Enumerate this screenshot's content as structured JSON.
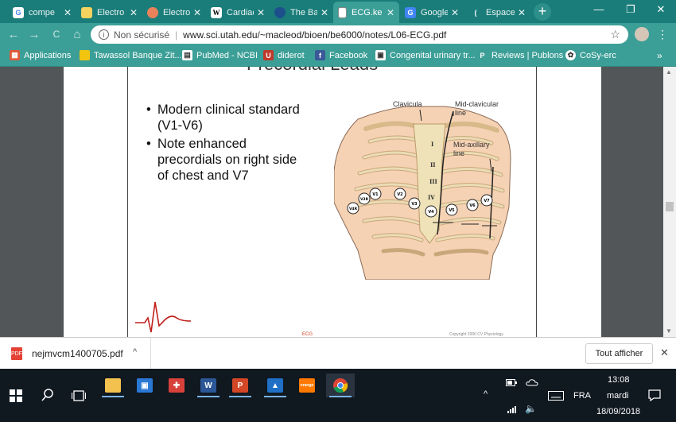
{
  "tabs": [
    {
      "label": "compe",
      "fav_text": "G",
      "fav_bg": "#ffffff",
      "fav_fg": "#4285f4"
    },
    {
      "label": "Electro",
      "fav_text": "",
      "fav_bg": "#f4d35e",
      "fav_fg": "#333"
    },
    {
      "label": "Electro",
      "fav_text": "",
      "fav_bg": "#e9825a",
      "fav_fg": "#fff"
    },
    {
      "label": "Cardiac",
      "fav_text": "W",
      "fav_bg": "#ffffff",
      "fav_fg": "#000"
    },
    {
      "label": "The Ba",
      "fav_text": "",
      "fav_bg": "#1d4f8c",
      "fav_fg": "#fff"
    },
    {
      "label": "ECG.ke",
      "fav_text": "",
      "fav_bg": "#ffffff",
      "fav_fg": "#555"
    },
    {
      "label": "Google",
      "fav_text": "G",
      "fav_bg": "#4285f4",
      "fav_fg": "#fff"
    },
    {
      "label": "Espace",
      "fav_text": "(",
      "fav_bg": "#3c9f97",
      "fav_fg": "#fff"
    }
  ],
  "window": {
    "minimize": "—",
    "restore": "❐",
    "close": "✕"
  },
  "address": {
    "security_label": "Non sécurisé",
    "url": "www.sci.utah.edu/~macleod/bioen/be6000/notes/L06-ECG.pdf"
  },
  "nav": {
    "back": "←",
    "forward": "→",
    "reload": "C",
    "home": "⌂"
  },
  "bookmarks": [
    {
      "label": "Applications",
      "icon_bg": "#e05a3a",
      "icon_text": "▦"
    },
    {
      "label": "Tawassol Banque Zit...",
      "icon_bg": "#f1c40f",
      "icon_text": ""
    },
    {
      "label": "PubMed - NCBI",
      "icon_bg": "#ffffff",
      "icon_text": "▤"
    },
    {
      "label": "diderot",
      "icon_bg": "#c0392b",
      "icon_text": "U"
    },
    {
      "label": "Facebook",
      "icon_bg": "#3b5998",
      "icon_text": "f"
    },
    {
      "label": "Congenital urinary tr...",
      "icon_bg": "#ffffff",
      "icon_text": "▣"
    },
    {
      "label": "Reviews | Publons",
      "icon_bg": "#3c9f97",
      "icon_text": "P"
    },
    {
      "label": "CoSy-erc",
      "icon_bg": "#ffffff",
      "icon_text": "✿"
    }
  ],
  "bookmarks_more": "»",
  "slide": {
    "title": "Precordial Leads",
    "bullets": [
      {
        "text": "Modern clinical standard\n(V1-V6)"
      },
      {
        "text": "Note enhanced\nprecordials on right side\nof chest and V7"
      }
    ],
    "figure_labels": {
      "clavicula": "Clavicula",
      "mid_clavicular": "Mid-clavicular\nline",
      "mid_axillary": "Mid-axillary\nline",
      "ribs": [
        "I",
        "II",
        "III",
        "IV"
      ],
      "leads": [
        "V4R",
        "V3R",
        "V1",
        "V2",
        "V3",
        "V4",
        "V5",
        "V6",
        "V7"
      ]
    },
    "footer_left": "ECG",
    "footer_right": "Copyright 2000 CV Physiology"
  },
  "download": {
    "filename": "nejmvcm1400705.pdf",
    "show_all": "Tout afficher",
    "close": "✕",
    "file_icon_text": "PDF"
  },
  "taskbar": {
    "time": "13:08",
    "day": "mardi",
    "date": "18/09/2018",
    "lang": "FRA",
    "apps": [
      {
        "name": "file-explorer",
        "bg": "#f2c14e",
        "text": ""
      },
      {
        "name": "store",
        "bg": "#2b78d4",
        "text": "🛍"
      },
      {
        "name": "gift",
        "bg": "#d7413a",
        "text": "🎁"
      },
      {
        "name": "word",
        "bg": "#2b5797",
        "text": "W"
      },
      {
        "name": "powerpoint",
        "bg": "#d24726",
        "text": "P"
      },
      {
        "name": "photos",
        "bg": "#1f6fc5",
        "text": "▲"
      },
      {
        "name": "orange",
        "bg": "#ff7900",
        "text": "orange"
      },
      {
        "name": "chrome",
        "bg": "#db4437",
        "text": "●"
      }
    ]
  }
}
